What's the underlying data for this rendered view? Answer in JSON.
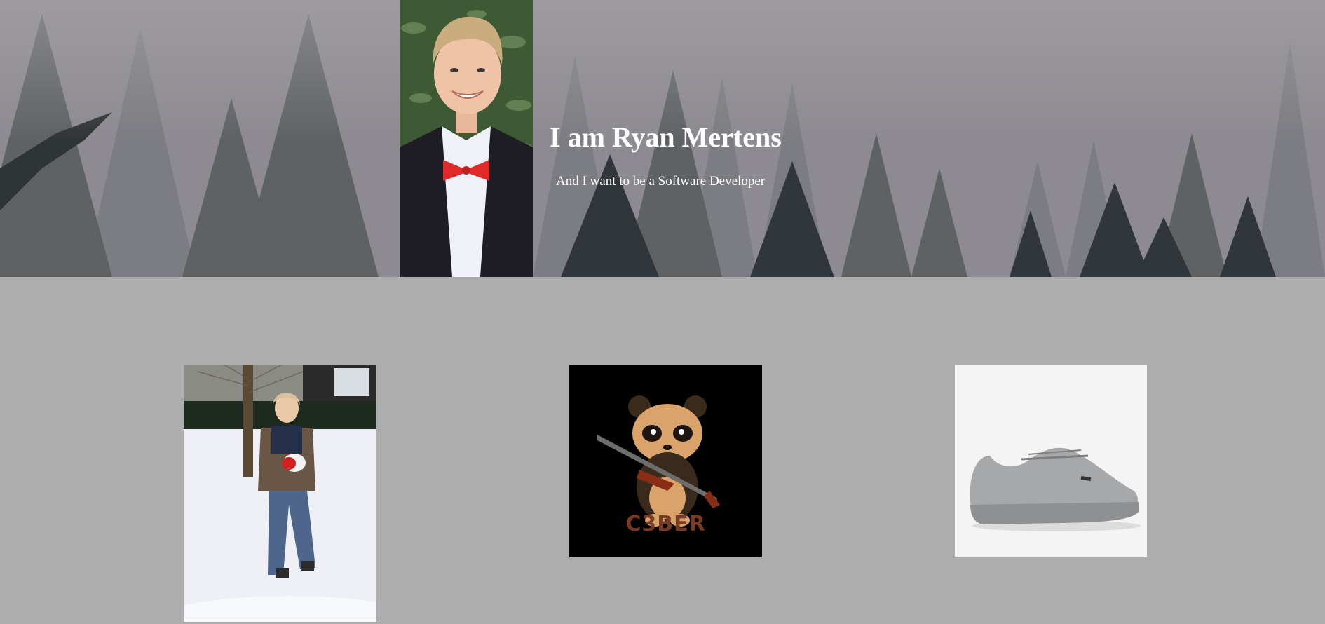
{
  "hero": {
    "title": "I am Ryan Mertens",
    "subtitle": "And I want to be a Software Developer",
    "background_image": "foggy-pine-forest",
    "portrait_image": "ryan-portrait-bow-tie"
  },
  "gallery": {
    "items": [
      {
        "image": "child-in-snow-photo"
      },
      {
        "image": "panda-logo",
        "logo_text": "C3BER"
      },
      {
        "image": "grey-sneaker-photo"
      }
    ]
  },
  "colors": {
    "page_background": "#adadad",
    "hero_text": "#ffffff",
    "bow_tie": "#e02a2a"
  }
}
